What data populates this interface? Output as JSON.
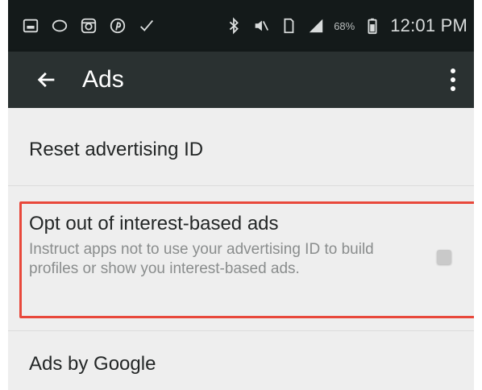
{
  "status_bar": {
    "icons_left": [
      "gallery-icon",
      "chat-bubble-icon",
      "instagram-icon",
      "pinterest-icon",
      "checkmark-icon"
    ],
    "icons_right": [
      "bluetooth-icon",
      "mute-icon",
      "sim-icon",
      "signal-icon"
    ],
    "battery_percent": "68%",
    "clock": "12:01 PM"
  },
  "app_bar": {
    "title": "Ads",
    "back_icon": "arrow-back-icon",
    "overflow_icon": "more-vert-icon"
  },
  "settings": {
    "reset_advertising_id": {
      "title": "Reset advertising ID"
    },
    "opt_out": {
      "title": "Opt out of interest-based ads",
      "summary": "Instruct apps not to use your advertising ID to build profiles or show you interest-based ads.",
      "checked": false
    },
    "ads_by_google": {
      "title": "Ads by Google"
    }
  },
  "colors": {
    "status_bar_bg": "#141a1a",
    "app_bar_bg": "#2a3131",
    "content_bg": "#eeeeee",
    "highlight": "#e8483b"
  }
}
